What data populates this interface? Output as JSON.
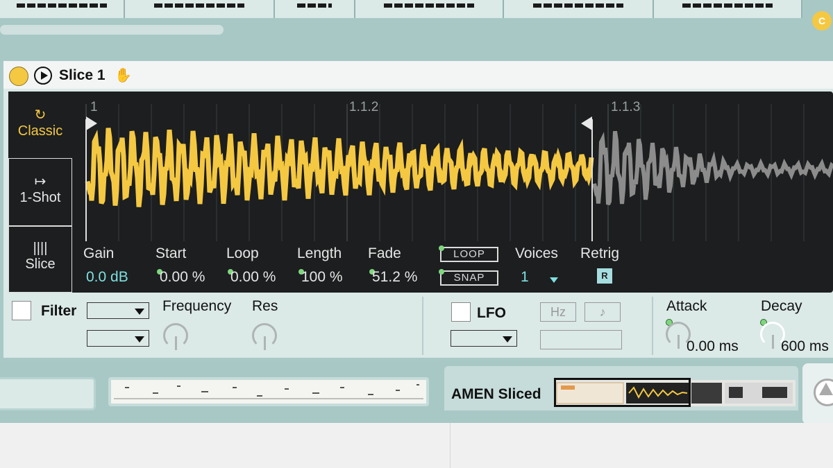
{
  "header": {
    "device_title": "Slice 1",
    "badge": "C"
  },
  "modes": [
    {
      "label": "Classic",
      "icon": "loop-arrow-icon"
    },
    {
      "label": "1-Shot",
      "icon": "arrow-to-bar-icon"
    },
    {
      "label": "Slice",
      "icon": "slice-bars-icon"
    }
  ],
  "ruler": [
    "1",
    "1.1.2",
    "1.1.3"
  ],
  "params": {
    "gain": {
      "label": "Gain",
      "value": "0.0 dB"
    },
    "start": {
      "label": "Start",
      "value": "0.00 %"
    },
    "loop": {
      "label": "Loop",
      "value": "0.00 %"
    },
    "length": {
      "label": "Length",
      "value": "100 %"
    },
    "fade": {
      "label": "Fade",
      "value": "51.2 %"
    },
    "loop_toggle": "LOOP",
    "snap_toggle": "SNAP",
    "voices": {
      "label": "Voices",
      "value": "1"
    },
    "retrig": {
      "label": "Retrig",
      "button": "R"
    }
  },
  "filter": {
    "label": "Filter",
    "frequency_label": "Frequency",
    "res_label": "Res"
  },
  "lfo": {
    "label": "LFO",
    "hz_label": "Hz",
    "note_label": "♪"
  },
  "envelope": {
    "attack": {
      "label": "Attack",
      "value": "0.00 ms"
    },
    "decay": {
      "label": "Decay",
      "value": "600 ms"
    }
  },
  "clip": {
    "name": "AMEN Sliced"
  },
  "colors": {
    "accent": "#f5c842",
    "panel": "#1c1e1f",
    "teal": "#7fe0e0",
    "inactive_wave": "#8c8c8c"
  }
}
